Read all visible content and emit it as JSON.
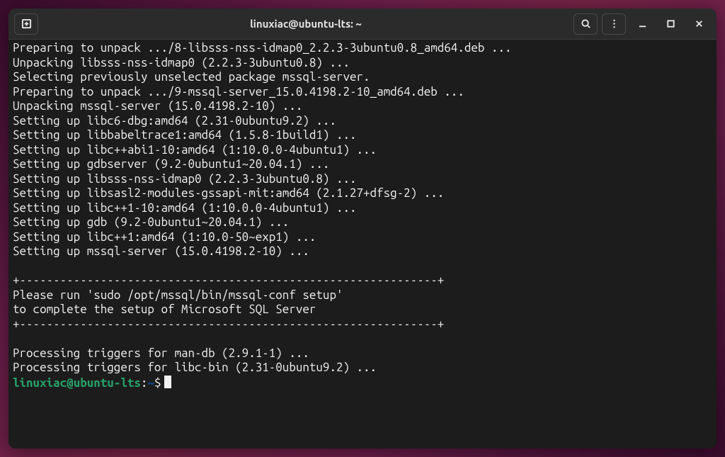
{
  "window": {
    "title": "linuxiac@ubuntu-lts: ~"
  },
  "prompt": {
    "user": "linuxiac",
    "host": "ubuntu-lts",
    "path": "~",
    "symbol": "$"
  },
  "icons": {
    "newtab": "new-tab-icon",
    "search": "search-icon",
    "menu": "menu-icon",
    "minimize": "minimize-icon",
    "maximize": "maximize-icon",
    "close": "close-icon"
  },
  "lines": [
    "Preparing to unpack .../8-libsss-nss-idmap0_2.2.3-3ubuntu0.8_amd64.deb ...",
    "Unpacking libsss-nss-idmap0 (2.2.3-3ubuntu0.8) ...",
    "Selecting previously unselected package mssql-server.",
    "Preparing to unpack .../9-mssql-server_15.0.4198.2-10_amd64.deb ...",
    "Unpacking mssql-server (15.0.4198.2-10) ...",
    "Setting up libc6-dbg:amd64 (2.31-0ubuntu9.2) ...",
    "Setting up libbabeltrace1:amd64 (1.5.8-1build1) ...",
    "Setting up libc++abi1-10:amd64 (1:10.0.0-4ubuntu1) ...",
    "Setting up gdbserver (9.2-0ubuntu1~20.04.1) ...",
    "Setting up libsss-nss-idmap0 (2.2.3-3ubuntu0.8) ...",
    "Setting up libsasl2-modules-gssapi-mit:amd64 (2.1.27+dfsg-2) ...",
    "Setting up libc++1-10:amd64 (1:10.0.0-4ubuntu1) ...",
    "Setting up gdb (9.2-0ubuntu1~20.04.1) ...",
    "Setting up libc++1:amd64 (1:10.0-50~exp1) ...",
    "Setting up mssql-server (15.0.4198.2-10) ...",
    "",
    "+--------------------------------------------------------------+",
    "Please run 'sudo /opt/mssql/bin/mssql-conf setup'",
    "to complete the setup of Microsoft SQL Server",
    "+--------------------------------------------------------------+",
    "",
    "Processing triggers for man-db (2.9.1-1) ...",
    "Processing triggers for libc-bin (2.31-0ubuntu9.2) ..."
  ]
}
